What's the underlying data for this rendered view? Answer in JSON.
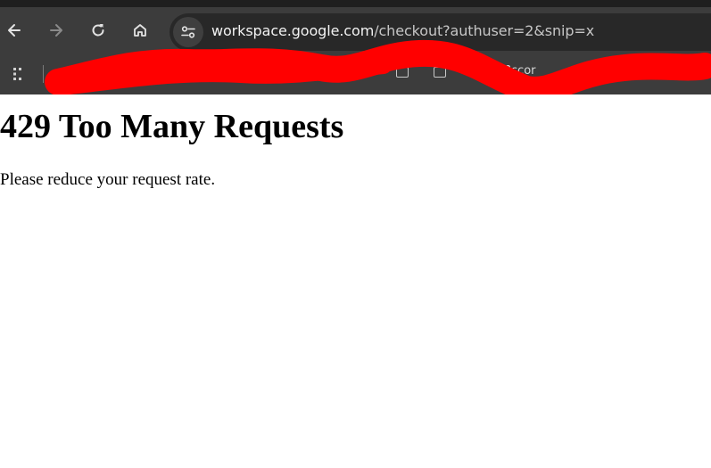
{
  "browser": {
    "url_host": "workspace.google.com",
    "url_path": "/checkout?authuser=2&snip=x",
    "bookmarks_partial_text": "?ccor",
    "icons": {
      "back": "arrow-left-icon",
      "forward": "arrow-right-icon",
      "reload": "reload-icon",
      "home": "home-icon",
      "site_info": "tune-icon",
      "apps": "apps-grid-icon"
    },
    "colors": {
      "chrome_bg": "#3c3c3c",
      "omnibox_bg": "#282828",
      "redaction": "#ff0000"
    }
  },
  "page": {
    "title": "429 Too Many Requests",
    "message": "Please reduce your request rate."
  }
}
